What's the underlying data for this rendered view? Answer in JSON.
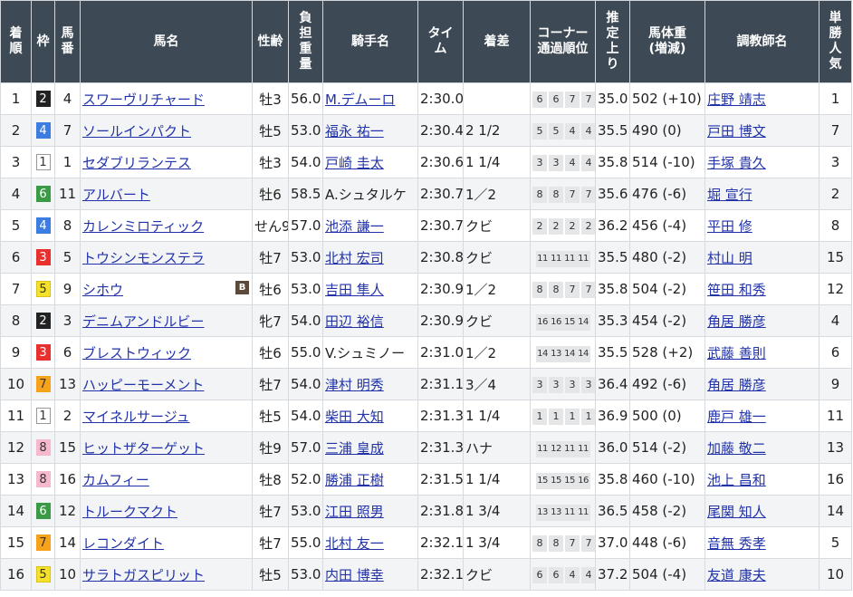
{
  "headers": {
    "rank": "着\n順",
    "waku": "枠",
    "num": "馬\n番",
    "horse": "馬名",
    "sexage": "性齢",
    "weight": "負\n担\n重\n量",
    "jockey": "騎手名",
    "time": "タイ\nム",
    "margin": "着差",
    "corner": "コーナー\n通過順位",
    "last3f": "推\n定\n上\nり",
    "bodyweight": "馬体重\n(増減)",
    "trainer": "調教師名",
    "pop": "単\n勝\n人\n気"
  },
  "waku_colors": {
    "1": {
      "bg": "#ffffff",
      "fg": "#333333",
      "border": "#999999"
    },
    "2": {
      "bg": "#222222",
      "fg": "#ffffff",
      "border": "#222222"
    },
    "3": {
      "bg": "#e8312f",
      "fg": "#ffffff",
      "border": "#e8312f"
    },
    "4": {
      "bg": "#3b7de0",
      "fg": "#ffffff",
      "border": "#3b7de0"
    },
    "5": {
      "bg": "#f5e12a",
      "fg": "#333333",
      "border": "#d9c21a"
    },
    "6": {
      "bg": "#3a9a45",
      "fg": "#ffffff",
      "border": "#3a9a45"
    },
    "7": {
      "bg": "#f7a21b",
      "fg": "#333333",
      "border": "#f7a21b"
    },
    "8": {
      "bg": "#f5b8cc",
      "fg": "#333333",
      "border": "#f5b8cc"
    }
  },
  "rows": [
    {
      "rank": "1",
      "waku": "2",
      "num": "4",
      "horse": "スワーヴリチャード",
      "blinker": "",
      "sexage": "牡3",
      "weight": "56.0",
      "jockey": "M.デムーロ",
      "jockey_link": true,
      "time": "2:30.0",
      "margin": "",
      "corners": [
        "6",
        "6",
        "7",
        "7"
      ],
      "last3f": "35.0",
      "bodyweight": "502 (+10)",
      "trainer": "庄野 靖志",
      "pop": "1"
    },
    {
      "rank": "2",
      "waku": "4",
      "num": "7",
      "horse": "ソールインパクト",
      "blinker": "",
      "sexage": "牡5",
      "weight": "53.0",
      "jockey": "福永 祐一",
      "jockey_link": true,
      "time": "2:30.4",
      "margin": "2 1/2",
      "corners": [
        "5",
        "5",
        "4",
        "4"
      ],
      "last3f": "35.5",
      "bodyweight": "490 (0)",
      "trainer": "戸田 博文",
      "pop": "7"
    },
    {
      "rank": "3",
      "waku": "1",
      "num": "1",
      "horse": "セダブリランテス",
      "blinker": "",
      "sexage": "牡3",
      "weight": "54.0",
      "jockey": "戸崎 圭太",
      "jockey_link": true,
      "time": "2:30.6",
      "margin": "1 1/4",
      "corners": [
        "3",
        "3",
        "4",
        "4"
      ],
      "last3f": "35.8",
      "bodyweight": "514 (-10)",
      "trainer": "手塚 貴久",
      "pop": "3"
    },
    {
      "rank": "4",
      "waku": "6",
      "num": "11",
      "horse": "アルバート",
      "blinker": "",
      "sexage": "牡6",
      "weight": "58.5",
      "jockey": "A.シュタルケ",
      "jockey_link": false,
      "time": "2:30.7",
      "margin": "1／2",
      "corners": [
        "8",
        "8",
        "7",
        "7"
      ],
      "last3f": "35.6",
      "bodyweight": "476 (-6)",
      "trainer": "堀 宣行",
      "pop": "2"
    },
    {
      "rank": "5",
      "waku": "4",
      "num": "8",
      "horse": "カレンミロティック",
      "blinker": "",
      "sexage": "せん9",
      "weight": "57.0",
      "jockey": "池添 謙一",
      "jockey_link": true,
      "time": "2:30.7",
      "margin": "クビ",
      "corners": [
        "2",
        "2",
        "2",
        "2"
      ],
      "last3f": "36.2",
      "bodyweight": "456 (-4)",
      "trainer": "平田 修",
      "pop": "8"
    },
    {
      "rank": "6",
      "waku": "3",
      "num": "5",
      "horse": "トウシンモンステラ",
      "blinker": "",
      "sexage": "牡7",
      "weight": "53.0",
      "jockey": "北村 宏司",
      "jockey_link": true,
      "time": "2:30.8",
      "margin": "クビ",
      "corners": [
        "11",
        "11",
        "11",
        "11"
      ],
      "last3f": "35.5",
      "bodyweight": "480 (-2)",
      "trainer": "村山 明",
      "pop": "15"
    },
    {
      "rank": "7",
      "waku": "5",
      "num": "9",
      "horse": "シホウ",
      "blinker": "B",
      "sexage": "牡6",
      "weight": "53.0",
      "jockey": "吉田 隼人",
      "jockey_link": true,
      "time": "2:30.9",
      "margin": "1／2",
      "corners": [
        "8",
        "8",
        "7",
        "7"
      ],
      "last3f": "35.8",
      "bodyweight": "504 (-2)",
      "trainer": "笹田 和秀",
      "pop": "12"
    },
    {
      "rank": "8",
      "waku": "2",
      "num": "3",
      "horse": "デニムアンドルビー",
      "blinker": "",
      "sexage": "牝7",
      "weight": "54.0",
      "jockey": "田辺 裕信",
      "jockey_link": true,
      "time": "2:30.9",
      "margin": "クビ",
      "corners": [
        "16",
        "16",
        "15",
        "14"
      ],
      "last3f": "35.3",
      "bodyweight": "454 (-2)",
      "trainer": "角居 勝彦",
      "pop": "4"
    },
    {
      "rank": "9",
      "waku": "3",
      "num": "6",
      "horse": "ブレストウィック",
      "blinker": "",
      "sexage": "牡6",
      "weight": "55.0",
      "jockey": "V.シュミノー",
      "jockey_link": false,
      "time": "2:31.0",
      "margin": "1／2",
      "corners": [
        "14",
        "13",
        "14",
        "14"
      ],
      "last3f": "35.5",
      "bodyweight": "528 (+2)",
      "trainer": "武藤 善則",
      "pop": "6"
    },
    {
      "rank": "10",
      "waku": "7",
      "num": "13",
      "horse": "ハッピーモーメント",
      "blinker": "",
      "sexage": "牡7",
      "weight": "54.0",
      "jockey": "津村 明秀",
      "jockey_link": true,
      "time": "2:31.1",
      "margin": "3／4",
      "corners": [
        "3",
        "3",
        "3",
        "3"
      ],
      "last3f": "36.4",
      "bodyweight": "492 (-6)",
      "trainer": "角居 勝彦",
      "pop": "9"
    },
    {
      "rank": "11",
      "waku": "1",
      "num": "2",
      "horse": "マイネルサージュ",
      "blinker": "",
      "sexage": "牡5",
      "weight": "54.0",
      "jockey": "柴田 大知",
      "jockey_link": true,
      "time": "2:31.3",
      "margin": "1 1/4",
      "corners": [
        "1",
        "1",
        "1",
        "1"
      ],
      "last3f": "36.9",
      "bodyweight": "500 (0)",
      "trainer": "鹿戸 雄一",
      "pop": "11"
    },
    {
      "rank": "12",
      "waku": "8",
      "num": "15",
      "horse": "ヒットザターゲット",
      "blinker": "",
      "sexage": "牡9",
      "weight": "57.0",
      "jockey": "三浦 皇成",
      "jockey_link": true,
      "time": "2:31.3",
      "margin": "ハナ",
      "corners": [
        "11",
        "12",
        "11",
        "11"
      ],
      "last3f": "36.0",
      "bodyweight": "514 (-2)",
      "trainer": "加藤 敬二",
      "pop": "13"
    },
    {
      "rank": "13",
      "waku": "8",
      "num": "16",
      "horse": "カムフィー",
      "blinker": "",
      "sexage": "牡8",
      "weight": "52.0",
      "jockey": "勝浦 正樹",
      "jockey_link": true,
      "time": "2:31.5",
      "margin": "1 1/4",
      "corners": [
        "15",
        "15",
        "15",
        "16"
      ],
      "last3f": "35.8",
      "bodyweight": "460 (-10)",
      "trainer": "池上 昌和",
      "pop": "16"
    },
    {
      "rank": "14",
      "waku": "6",
      "num": "12",
      "horse": "トルークマクト",
      "blinker": "",
      "sexage": "牡7",
      "weight": "53.0",
      "jockey": "江田 照男",
      "jockey_link": true,
      "time": "2:31.8",
      "margin": "1 3/4",
      "corners": [
        "13",
        "13",
        "11",
        "11"
      ],
      "last3f": "36.5",
      "bodyweight": "458 (-2)",
      "trainer": "尾関 知人",
      "pop": "14"
    },
    {
      "rank": "15",
      "waku": "7",
      "num": "14",
      "horse": "レコンダイト",
      "blinker": "",
      "sexage": "牡7",
      "weight": "55.0",
      "jockey": "北村 友一",
      "jockey_link": true,
      "time": "2:32.1",
      "margin": "1 3/4",
      "corners": [
        "8",
        "8",
        "7",
        "7"
      ],
      "last3f": "37.0",
      "bodyweight": "448 (-6)",
      "trainer": "音無 秀孝",
      "pop": "5"
    },
    {
      "rank": "16",
      "waku": "5",
      "num": "10",
      "horse": "サラトガスピリット",
      "blinker": "",
      "sexage": "牡5",
      "weight": "53.0",
      "jockey": "内田 博幸",
      "jockey_link": true,
      "time": "2:32.1",
      "margin": "クビ",
      "corners": [
        "6",
        "6",
        "4",
        "4"
      ],
      "last3f": "37.2",
      "bodyweight": "504 (-4)",
      "trainer": "友道 康夫",
      "pop": "10"
    }
  ]
}
